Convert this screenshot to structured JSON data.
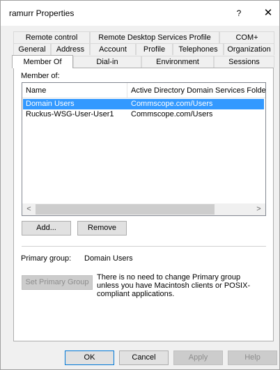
{
  "window": {
    "title": "ramurr Properties",
    "help_glyph": "?",
    "close_glyph": "✕"
  },
  "tabs": {
    "row1": [
      "Remote control",
      "Remote Desktop Services Profile",
      "COM+"
    ],
    "row2": [
      "General",
      "Address",
      "Account",
      "Profile",
      "Telephones",
      "Organization"
    ],
    "row3": [
      "Member Of",
      "Dial-in",
      "Environment",
      "Sessions"
    ],
    "active": "Member Of"
  },
  "member_of": {
    "label": "Member of:",
    "columns": [
      "Name",
      "Active Directory Domain Services Folder"
    ],
    "rows": [
      {
        "name": "Domain Users",
        "folder": "Commscope.com/Users",
        "selected": true
      },
      {
        "name": "Ruckus-WSG-User-User1",
        "folder": "Commscope.com/Users",
        "selected": false
      }
    ],
    "scroll_left": "<",
    "scroll_right": ">"
  },
  "buttons": {
    "add": "Add...",
    "remove": "Remove",
    "set_primary": "Set Primary Group"
  },
  "primary_group": {
    "label": "Primary group:",
    "value": "Domain Users",
    "note": "There is no need to change Primary group unless you have Macintosh clients or POSIX-compliant applications."
  },
  "dialog_buttons": {
    "ok": "OK",
    "cancel": "Cancel",
    "apply": "Apply",
    "help": "Help"
  }
}
